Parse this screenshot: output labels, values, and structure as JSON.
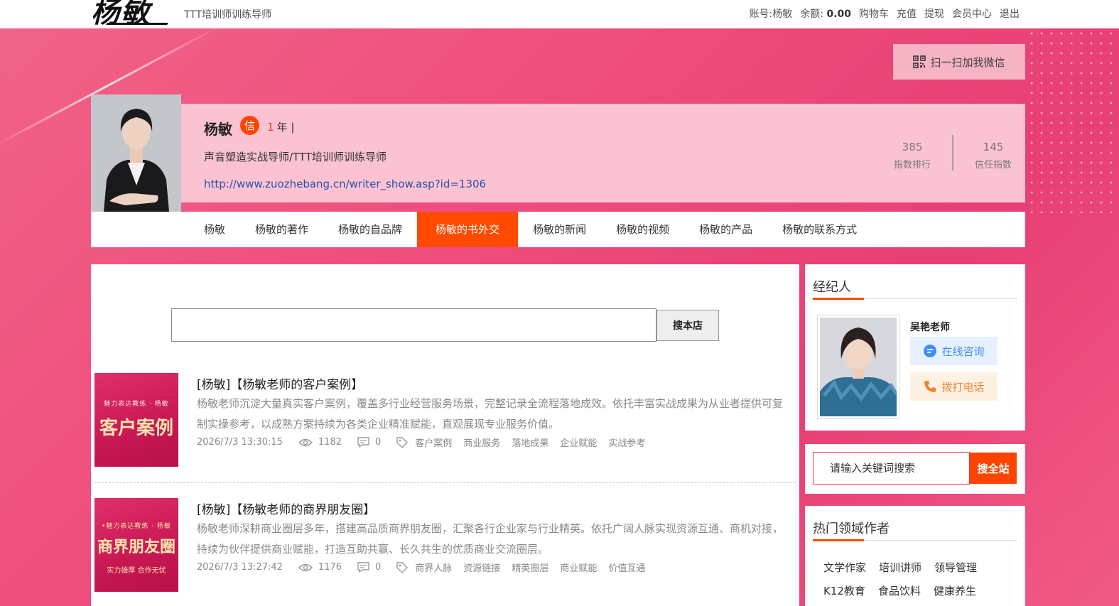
{
  "header": {
    "logo_text": "杨敏",
    "tagline": "TTT培训师训练导师",
    "account_label": "账号:",
    "account_name": "杨敏",
    "balance_label": "余额:",
    "balance_value": "0.00",
    "links": [
      "购物车",
      "充值",
      "提现",
      "会员中心",
      "退出"
    ]
  },
  "wechat_button": "扫一扫加我微信",
  "profile": {
    "name": "杨敏",
    "badge": "信",
    "years_num": "1",
    "years_text": "年 |",
    "title": "声音塑造实战导师/TTT培训师训练导师",
    "url": "http://www.zuozhebang.cn/writer_show.asp?id=1306",
    "stats": [
      {
        "value": "385",
        "label": "指数排行"
      },
      {
        "value": "145",
        "label": "信任指数"
      }
    ]
  },
  "nav": {
    "items": [
      "杨敏",
      "杨敏的著作",
      "杨敏的自品牌",
      "杨敏的书外交",
      "杨敏的新闻",
      "杨敏的视频",
      "杨敏的产品",
      "杨敏的联系方式"
    ],
    "active_index": 3
  },
  "store_search": {
    "placeholder": "",
    "button": "搜本店"
  },
  "articles": [
    {
      "thumb_small": "魅力表达教练 · 杨敏",
      "thumb_big": "客户案例",
      "title": "[杨敏]【杨敏老师的客户案例】",
      "desc": "杨敏老师沉淀大量真实客户案例，覆盖多行业经营服务场景，完整记录全流程落地成效。依托丰富实战成果为从业者提供可复制实操参考，以成熟方案持续为各类企业精准赋能，直观展现专业服务价值。",
      "time": "2026/7/3 13:30:15",
      "views": "1182",
      "comments": "0",
      "tags": [
        "客户案例",
        "商业服务",
        "落地成果",
        "企业赋能",
        "实战参考"
      ]
    },
    {
      "thumb_small": "•魅力表达教练 · 杨敏",
      "thumb_big": "商界朋友圈",
      "thumb_tiny": "实力雄厚  合作无忧",
      "title": "[杨敏]【杨敏老师的商界朋友圈】",
      "desc": "杨敏老师深耕商业圈层多年，搭建高品质商界朋友圈，汇聚各行企业家与行业精英。依托广阔人脉实现资源互通、商机对接，持续为伙伴提供商业赋能，打造互助共赢、长久共生的优质商业交流圈层。",
      "time": "2026/7/3 13:27:42",
      "views": "1176",
      "comments": "0",
      "tags": [
        "商界人脉",
        "资源链接",
        "精英圈层",
        "商业赋能",
        "价值互通"
      ]
    }
  ],
  "agent": {
    "section_title": "经纪人",
    "name": "吴艳老师",
    "chat_label": "在线咨询",
    "call_label": "拨打电话"
  },
  "site_search": {
    "placeholder": "请输入关键词搜索",
    "button": "搜全站"
  },
  "hot": {
    "title": "热门领域作者",
    "tags": [
      "文学作家",
      "培训讲师",
      "领导管理",
      "K12教育",
      "食品饮料",
      "健康养生"
    ]
  },
  "colors": {
    "accent": "#ff4a00",
    "page_bg": "#ef4f7e",
    "profile_band": "#fbc3d1",
    "link": "#2a4fa8"
  }
}
